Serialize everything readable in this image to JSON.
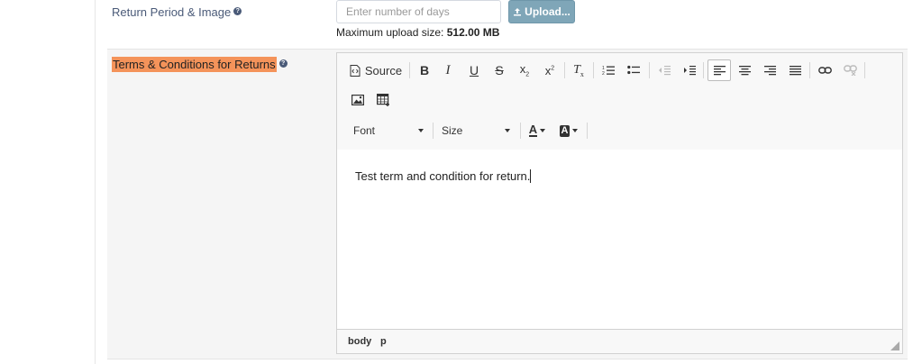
{
  "return_period": {
    "label": "Return Period & Image",
    "days_placeholder": "Enter number of days",
    "upload_label": "Upload...",
    "max_upload_prefix": "Maximum upload size:",
    "max_upload_value": "512.00 MB"
  },
  "terms": {
    "label": "Terms & Conditions for Returns"
  },
  "editor": {
    "source_label": "Source",
    "font_label": "Font",
    "size_label": "Size",
    "content": "Test term and condition for return.",
    "path": [
      "body",
      "p"
    ]
  },
  "colors": {
    "highlight": "#f4935a",
    "upload_button": "#7fa6b8",
    "label_blue": "#4a5a78"
  }
}
